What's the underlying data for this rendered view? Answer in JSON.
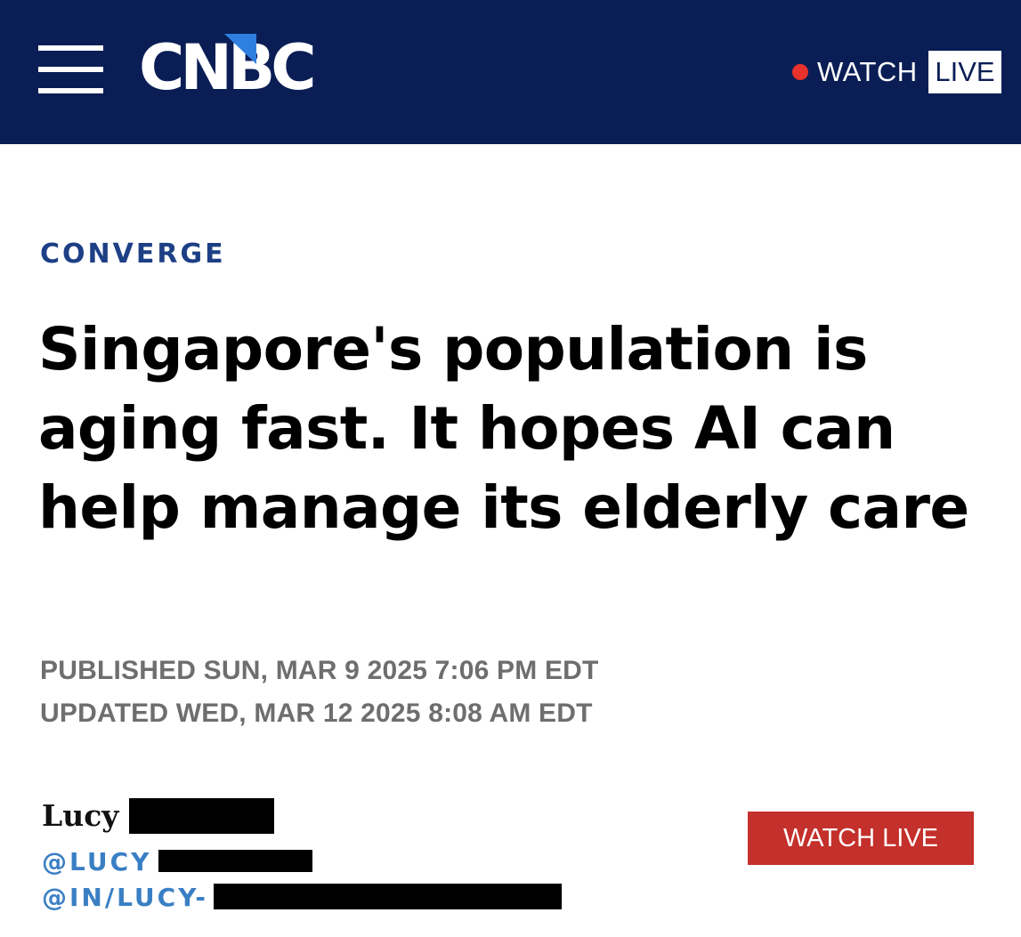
{
  "header": {
    "logo_text": "CNBC",
    "watch_label": "WATCH",
    "live_label": "LIVE",
    "colors": {
      "background": "#0a1e55",
      "live_dot": "#e8322b",
      "logo_accent": "#2f7fe0"
    },
    "icons": {
      "menu": "hamburger-menu-icon",
      "live": "red-dot-icon"
    }
  },
  "article": {
    "section": "CONVERGE",
    "headline": "Singapore's population is aging fast. It hopes AI can help manage its elderly care",
    "published": "PUBLISHED SUN, MAR 9 2025 7:06 PM EDT",
    "updated": "UPDATED WED, MAR 12 2025 8:08 AM EDT"
  },
  "byline": {
    "author_first_name": "Lucy",
    "twitter_handle_prefix": "@LUCY",
    "linkedin_prefix": "@IN/LUCY-",
    "colors": {
      "link": "#3a7fc4"
    }
  },
  "watch_live_button": {
    "label": "WATCH LIVE",
    "color": "#c4302b"
  }
}
